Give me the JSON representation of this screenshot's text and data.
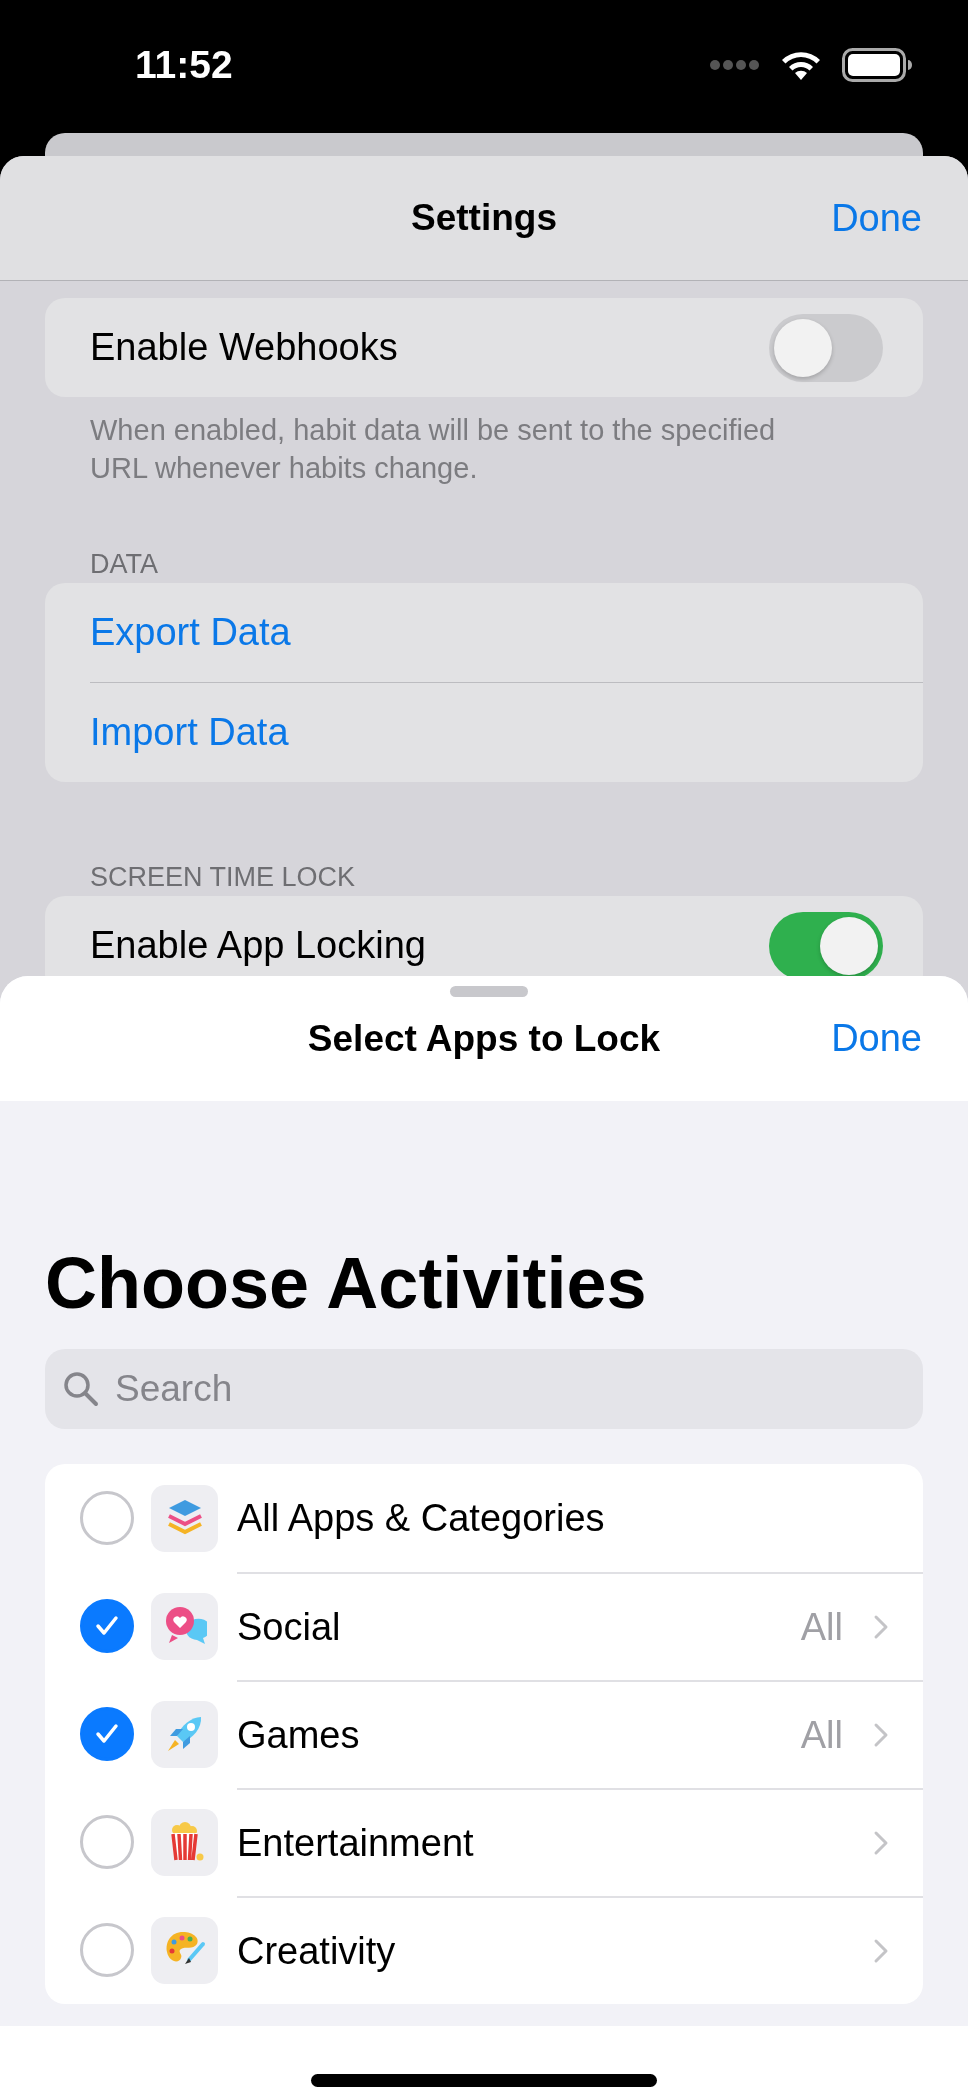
{
  "status_bar": {
    "time": "11:52"
  },
  "settings_sheet": {
    "title": "Settings",
    "done": "Done",
    "webhooks": {
      "label": "Enable Webhooks",
      "on": false,
      "footer": "When enabled, habit data will be sent to the specified URL whenever habits change."
    },
    "data_section": {
      "header": "DATA",
      "actions": [
        "Export Data",
        "Import Data"
      ]
    },
    "screen_time_section": {
      "header": "SCREEN TIME LOCK",
      "label": "Enable App Locking",
      "on": true
    }
  },
  "picker_sheet": {
    "title": "Select Apps to Lock",
    "done": "Done",
    "heading": "Choose Activities",
    "search": {
      "placeholder": "Search"
    },
    "categories": [
      {
        "kind": "all",
        "label": "All Apps & Categories",
        "selected": false
      },
      {
        "kind": "category",
        "label": "Social",
        "detail": "All",
        "selected": true
      },
      {
        "kind": "category",
        "label": "Games",
        "detail": "All",
        "selected": true
      },
      {
        "kind": "category",
        "label": "Entertainment",
        "selected": false
      },
      {
        "kind": "category",
        "label": "Creativity",
        "selected": false
      }
    ]
  }
}
